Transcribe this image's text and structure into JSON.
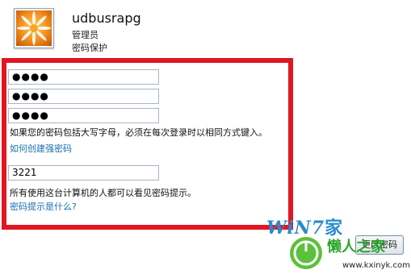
{
  "account": {
    "username": "udbusrapg",
    "role": "管理员",
    "status": "密码保护",
    "avatar_icon": "flower-avatar-icon"
  },
  "form": {
    "current_password": "●●●●",
    "new_password": "●●●●",
    "confirm_password": "●●●●",
    "caps_hint": "如果您的密码包括大写字母，必须在每次登录时以相同方式键入。",
    "strong_link": "如何创建强密码",
    "password_hint": "3221",
    "hint_notice": "所有使用这台计算机的人都可以看见密码提示。",
    "hint_link": "密码提示是什么?"
  },
  "button": {
    "label": "更改密码"
  },
  "watermark": {
    "win7_text": "WiN7",
    "brand_suffix": "家",
    "site_text": "懒人之家",
    "url": "www.kxinyk.com"
  },
  "colors": {
    "highlight": "#e01721",
    "link": "#1a6fb0",
    "watermark_blue": "#2a8bd0",
    "watermark_green": "#2aa62a"
  }
}
